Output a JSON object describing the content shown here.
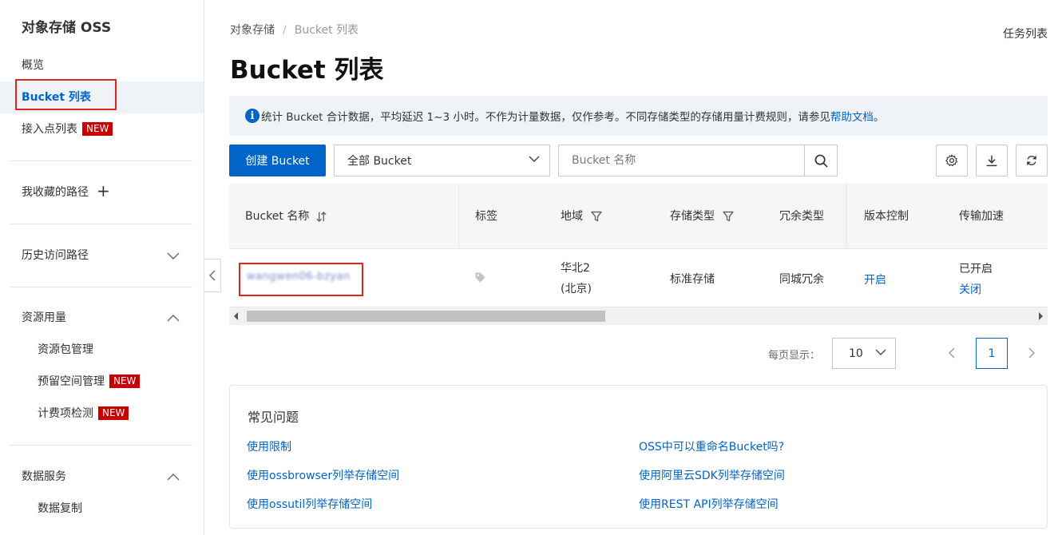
{
  "sidebar": {
    "title": "对象存储 OSS",
    "overview": "概览",
    "bucket_list": "Bucket 列表",
    "access_points": "接入点列表",
    "new_badge": "NEW",
    "favorites": "我收藏的路径",
    "history": "历史访问路径",
    "resource_usage": "资源用量",
    "resource_pack": "资源包管理",
    "reserved_space": "预留空间管理",
    "billing_check": "计费项检测",
    "data_service": "数据服务",
    "data_replication": "数据复制"
  },
  "breadcrumb": {
    "root": "对象存储",
    "separator": "/",
    "current": "Bucket 列表"
  },
  "header": {
    "task_list": "任务列表",
    "title": "Bucket 列表"
  },
  "notice": {
    "icon": "i",
    "text": "统计 Bucket 合计数据，平均延迟 1~3 小时。不作为计量数据，仅作参考。不同存储类型的存储用量计费规则，请参见",
    "link": "帮助文档",
    "suffix": "。"
  },
  "toolbar": {
    "create_button": "创建 Bucket",
    "filter_value": "全部 Bucket",
    "search_placeholder": "Bucket 名称"
  },
  "table": {
    "columns": {
      "name": "Bucket 名称",
      "tags": "标签",
      "region": "地域",
      "storage_class": "存储类型",
      "redundancy": "冗余类型",
      "versioning": "版本控制",
      "transfer_accel": "传输加速"
    },
    "rows": [
      {
        "name": "wangwen06-bzyan",
        "region_line1": "华北2",
        "region_line2": "(北京)",
        "storage_class": "标准存储",
        "redundancy": "同城冗余",
        "versioning": "开启",
        "transfer_status": "已开启",
        "transfer_action": "关闭"
      }
    ]
  },
  "pagination": {
    "page_size_label": "每页显示：",
    "page_size": "10",
    "current_page": "1"
  },
  "faq": {
    "title": "常见问题",
    "links": [
      "使用限制",
      "OSS中可以重命名Bucket吗?",
      "使用ossbrowser列举存储空间",
      "使用阿里云SDK列举存储空间",
      "使用ossutil列举存储空间",
      "使用REST API列举存储空间"
    ]
  },
  "colors": {
    "primary": "#0064c8",
    "new_badge": "#c80000",
    "highlight_box": "#e1251b"
  }
}
